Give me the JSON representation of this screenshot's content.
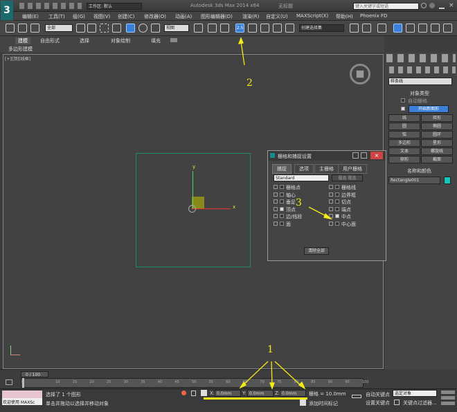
{
  "title": {
    "workspace_label": "工作区: 默认",
    "app_name": "Autodesk 3ds Max  2014 x64",
    "doc_name": "无标题",
    "search_placeholder": "键入关键字或短语"
  },
  "menus": [
    "编辑(E)",
    "工具(T)",
    "组(G)",
    "视图(V)",
    "创建(C)",
    "修改器(O)",
    "动画(A)",
    "图形编辑器(D)",
    "渲染(R)",
    "自定义(U)",
    "MAXScript(X)",
    "帮助(H)",
    "Phoenix FD"
  ],
  "toolbar": {
    "selection_filter": "全部",
    "ref_coord": "视图",
    "named_sel": "创建选择集"
  },
  "ribbon": {
    "tabs": [
      "建模",
      "自由形式",
      "选择",
      "对象绘制",
      "填充"
    ],
    "sub_label": "多边形建模"
  },
  "viewport": {
    "label": "[+][顶][线框]",
    "axis_x": "x",
    "axis_y": "y"
  },
  "command_panel": {
    "category": "样条线",
    "rollout_obj_type": "对象类型",
    "auto_grid": "自动栅格",
    "start_new_shape": "开始新图形",
    "buttons": [
      "线",
      "矩形",
      "圆",
      "椭圆",
      "弧",
      "圆环",
      "多边形",
      "星形",
      "文本",
      "螺旋线",
      "卵形",
      "截面"
    ],
    "rollout_name_color": "名称和颜色",
    "object_name": "Rectangle001",
    "object_color": "#14c7b6"
  },
  "snap_dialog": {
    "title": "栅格和捕捉设置",
    "tabs": [
      "捕捉",
      "选项",
      "主栅格",
      "用户栅格"
    ],
    "dropdown": "Standard",
    "override_label": "覆盖 覆盖",
    "items_left": [
      {
        "label": "栅格点",
        "checked": false
      },
      {
        "label": "轴心",
        "checked": false
      },
      {
        "label": "垂足",
        "checked": false
      },
      {
        "label": "顶点",
        "checked": true
      },
      {
        "label": "边/线段",
        "checked": false
      },
      {
        "label": "面",
        "checked": false
      }
    ],
    "items_right": [
      {
        "label": "栅格线",
        "checked": false
      },
      {
        "label": "边界框",
        "checked": false
      },
      {
        "label": "切点",
        "checked": false
      },
      {
        "label": "端点",
        "checked": false
      },
      {
        "label": "中点",
        "checked": true
      },
      {
        "label": "中心面",
        "checked": false
      }
    ],
    "clear_all": "清除全部"
  },
  "timeline": {
    "frame_counter": "0 / 100",
    "ticks": [
      "0",
      "10",
      "15",
      "20",
      "25",
      "30",
      "35",
      "40",
      "45",
      "50",
      "55",
      "60",
      "65",
      "70",
      "75",
      "80",
      "85",
      "90",
      "95",
      "100"
    ]
  },
  "status": {
    "welcome": "欢迎使用 MAXSc",
    "selected": "选择了 1 个图形",
    "prompt": "单击并拖动以选择并移动对象",
    "x_label": "X:",
    "x_value": "0.0mm",
    "y_label": "Y:",
    "y_value": "0.0mm",
    "z_label": "Z:",
    "z_value": "0.0mm",
    "grid": "栅格 = 10.0mm",
    "add_time_tag": "添加时间标记",
    "auto_key": "自动关键点",
    "set_key": "设置关键点",
    "selected_objects": "选定对象",
    "key_filters": "关键点过滤器..."
  },
  "annotations": {
    "label_1": "1",
    "label_2": "2",
    "label_3": "3"
  },
  "colors": {
    "annotation": "#f3ec17",
    "active_button": "#3a80d8"
  }
}
